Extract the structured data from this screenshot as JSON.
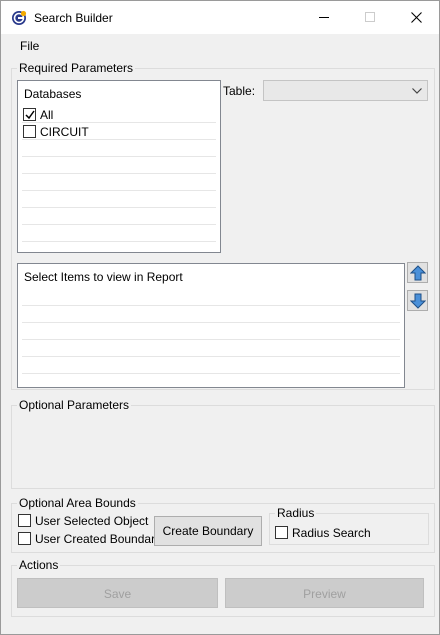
{
  "window": {
    "title": "Search Builder",
    "icon": "app-logo-icon",
    "controls": [
      "minimize-icon",
      "maximize-icon",
      "close-icon"
    ]
  },
  "menu": {
    "items": [
      {
        "label": "File"
      }
    ]
  },
  "required_parameters": {
    "label": "Required Parameters",
    "databases": {
      "header": "Databases",
      "items": [
        {
          "label": "All",
          "checked": true
        },
        {
          "label": "CIRCUIT",
          "checked": false
        }
      ]
    },
    "table": {
      "label": "Table:",
      "value": ""
    },
    "report_items": {
      "header": "Select Items to view in Report"
    },
    "move_up_icon": "arrow-up-icon",
    "move_down_icon": "arrow-down-icon"
  },
  "optional_parameters": {
    "label": "Optional Parameters"
  },
  "optional_area_bounds": {
    "label": "Optional Area Bounds",
    "user_selected_object": {
      "label": "User Selected Object",
      "checked": false
    },
    "user_created_boundary": {
      "label": "User Created Boundary",
      "checked": false
    },
    "create_boundary_label": "Create Boundary",
    "radius": {
      "label": "Radius",
      "radius_search": {
        "label": "Radius Search",
        "checked": false
      }
    }
  },
  "actions": {
    "label": "Actions",
    "save_label": "Save",
    "preview_label": "Preview"
  }
}
